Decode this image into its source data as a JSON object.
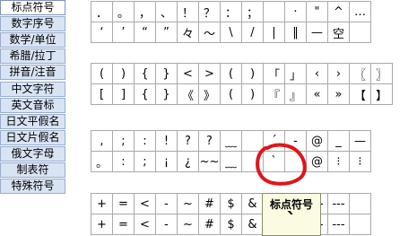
{
  "sidebar": {
    "items": [
      {
        "label": "标点符号"
      },
      {
        "label": "数字序号"
      },
      {
        "label": "数学/单位"
      },
      {
        "label": "希腊/拉丁"
      },
      {
        "label": "拼音/注音"
      },
      {
        "label": "中文字符"
      },
      {
        "label": "英文音标"
      },
      {
        "label": "日文平假名"
      },
      {
        "label": "日文片假名"
      },
      {
        "label": "俄文字母"
      },
      {
        "label": "制表符"
      },
      {
        "label": "特殊符号"
      }
    ]
  },
  "grids": [
    {
      "rows": [
        [
          "．",
          "。",
          "，",
          "、",
          "！",
          "？",
          "：",
          "；",
          "",
          "·",
          "\"",
          "^",
          "…"
        ],
        [
          "‘",
          "’",
          "“",
          "”",
          "々",
          "～",
          "\\",
          "/",
          "|",
          "‖",
          "—",
          "空"
        ]
      ]
    },
    {
      "rows": [
        [
          "(",
          ")",
          "{",
          "}",
          "<",
          ">",
          "(",
          ")",
          "「",
          "」",
          "‹",
          "›",
          "〖",
          "〗"
        ],
        [
          "[",
          "]",
          "{",
          "}",
          "《",
          "》",
          "(",
          ")",
          "『",
          "』",
          "«",
          "»",
          "【",
          "】"
        ]
      ]
    },
    {
      "rows": [
        [
          ",",
          ";",
          ":",
          "!",
          "?",
          "?",
          "﹏",
          "",
          "´",
          "-",
          "@",
          "_",
          "—"
        ],
        [
          "。",
          ":",
          ";",
          "¡",
          "¿",
          "~~",
          "﹏",
          "",
          "`",
          "",
          "@",
          "⁝",
          "⁝"
        ]
      ]
    },
    {
      "rows": [
        [
          "+",
          "=",
          "<",
          "-",
          "~",
          "#",
          "$",
          "&",
          "",
          "",
          "---",
          "---",
          ""
        ],
        [
          "+",
          "=",
          "<",
          "-",
          "~",
          "#",
          "$",
          "&",
          "",
          "",
          "---",
          "---",
          ""
        ]
      ]
    }
  ],
  "tooltip": {
    "label": "标点符号",
    "glyph": "`"
  },
  "colors": {
    "sidebar_bg": "#d8e4f4",
    "sidebar_active_bg": "#ffffff",
    "grid_border": "#a9a9a9",
    "tooltip_bg": "#fbfbe2",
    "annotation": "#e0161a"
  }
}
